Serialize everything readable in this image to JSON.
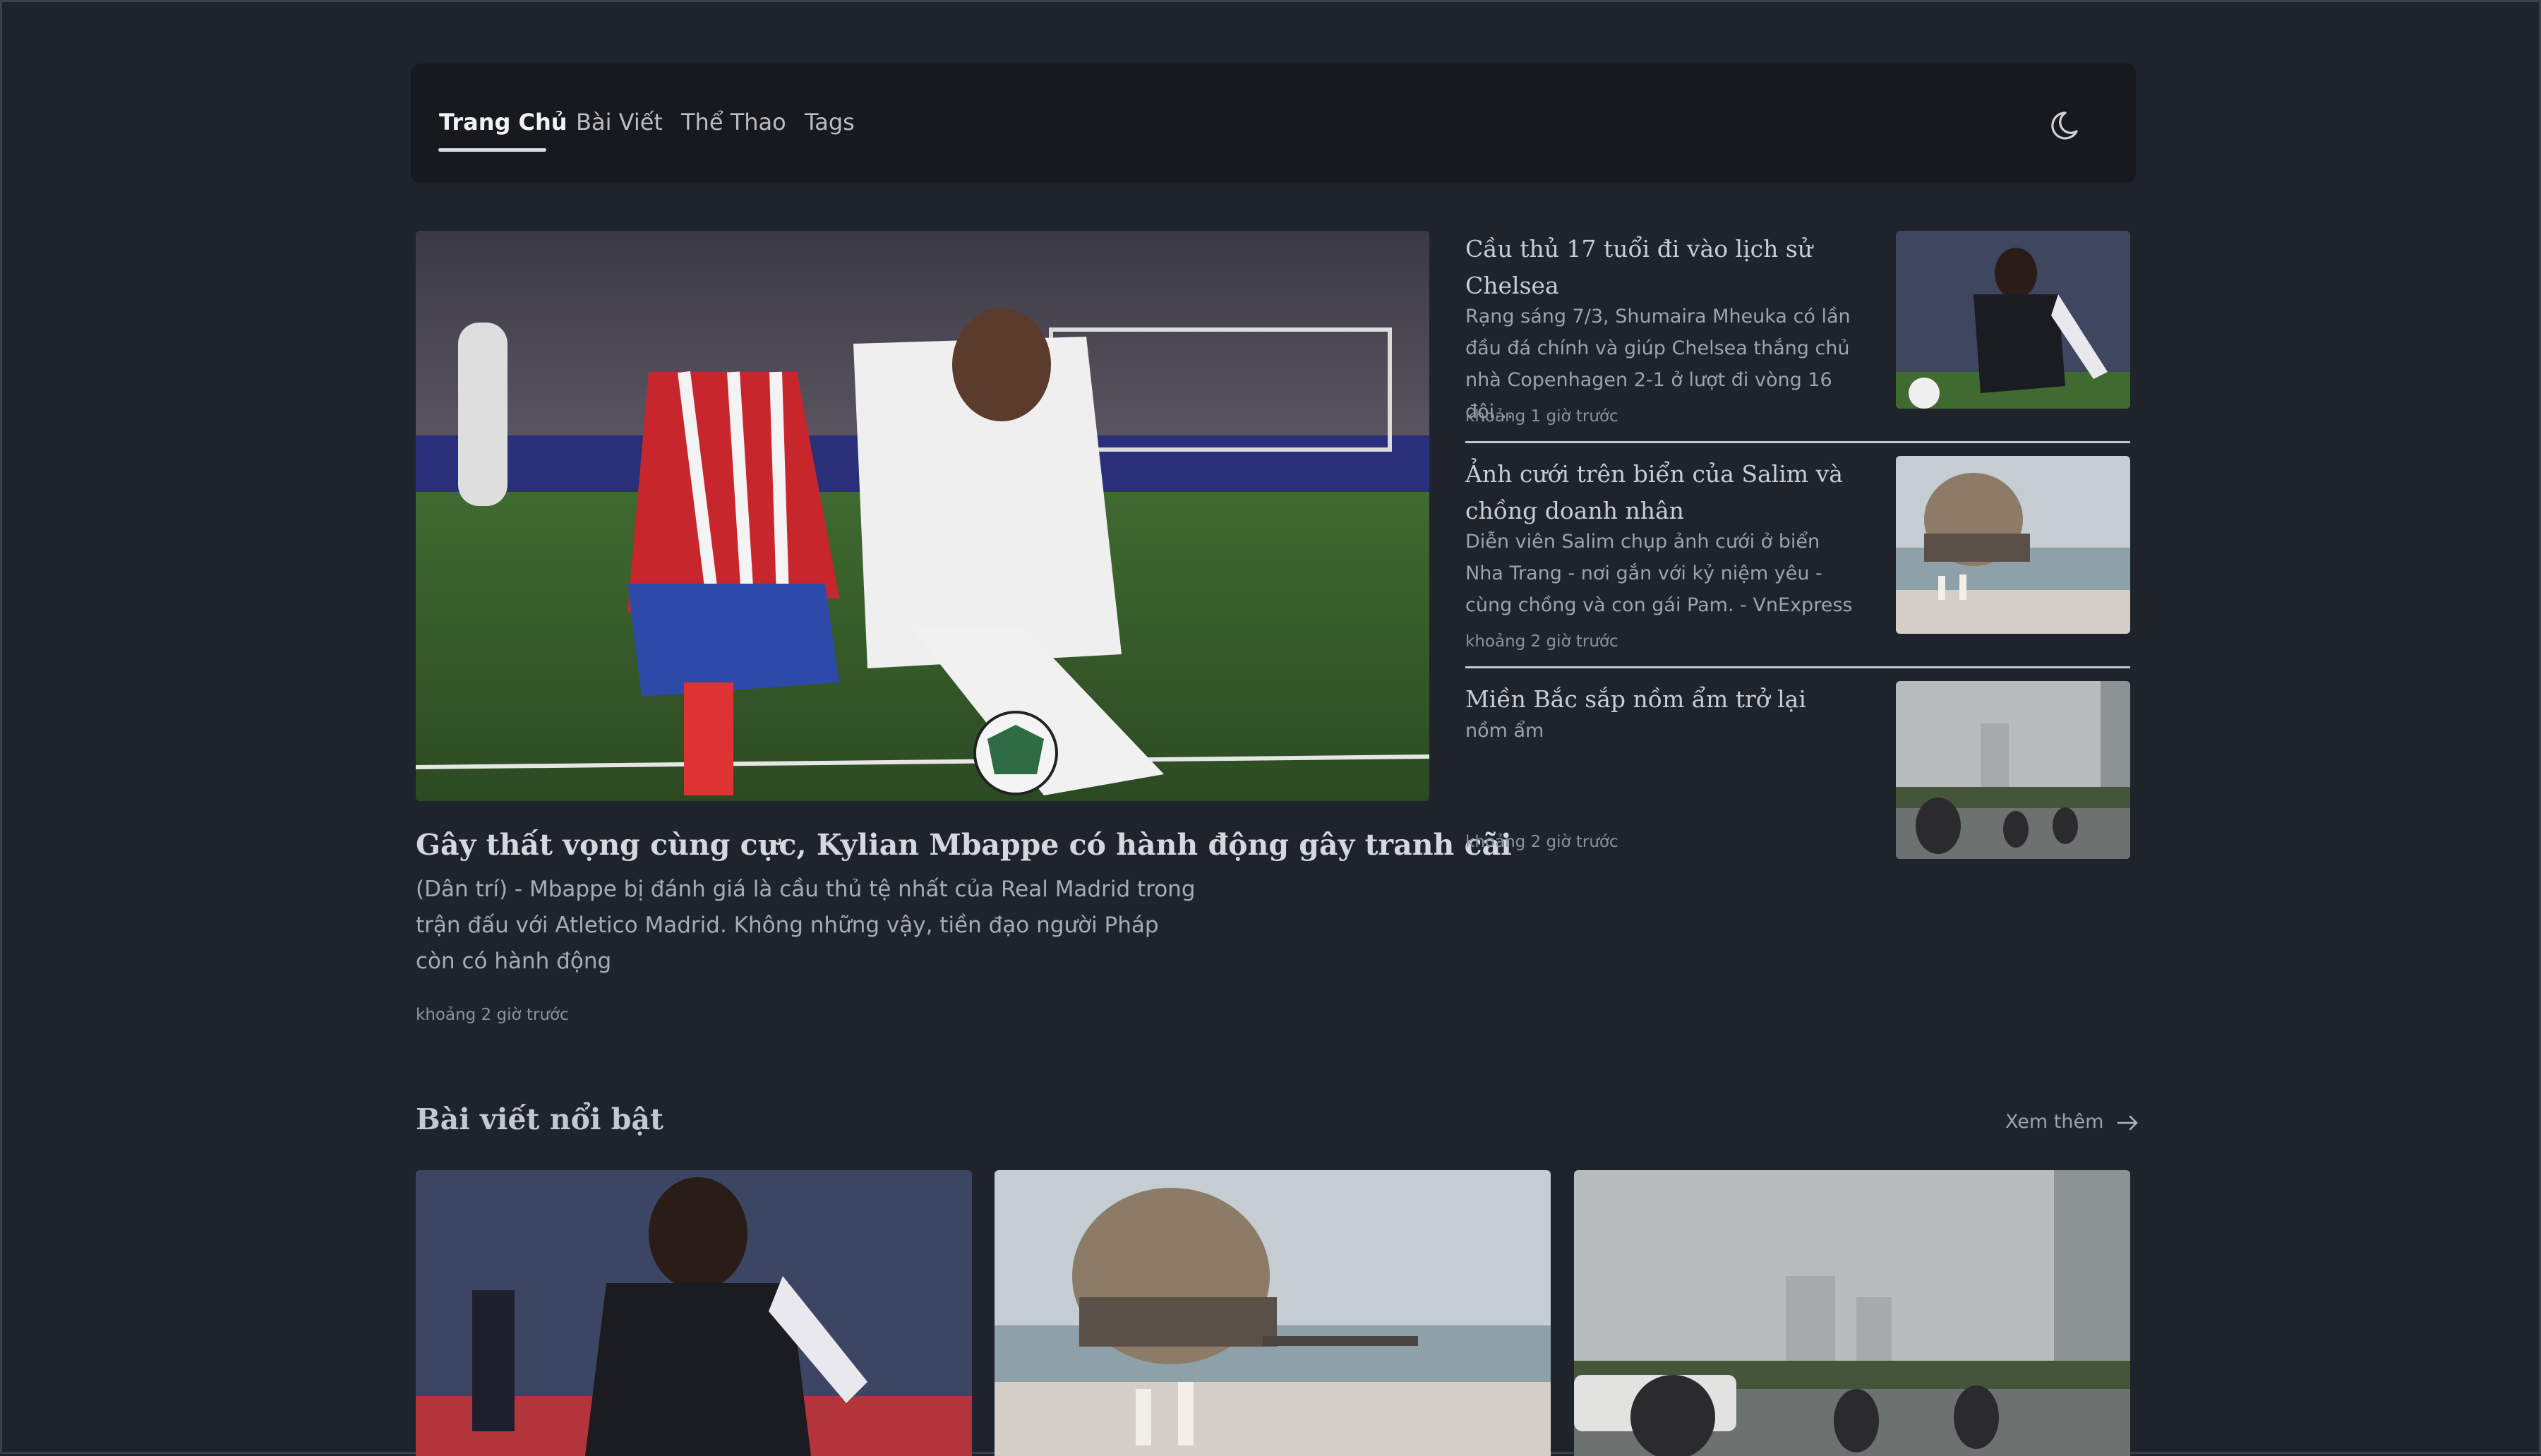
{
  "nav": {
    "items": [
      "Trang Chủ",
      "Bài Viết",
      "Thể Thao",
      "Tags"
    ],
    "active_index": 0,
    "theme_toggle_icon": "moon-icon"
  },
  "hero": {
    "title": "Gây thất vọng cùng cực, Kylian Mbappe có hành động gây tranh cãi",
    "description": "(Dân trí) - Mbappe bị đánh giá là cầu thủ tệ nhất của Real Madrid trong trận đấu với Atletico Madrid. Không những vậy, tiền đạo người Pháp còn có hành động",
    "time": "khoảng 2 giờ trước",
    "image_alt": "football-match-photo"
  },
  "side_articles": [
    {
      "title": "Cầu thủ 17 tuổi đi vào lịch sử Chelsea",
      "description": "Rạng sáng 7/3, Shumaira Mheuka có lần đầu đá chính và giúp Chelsea thắng chủ nhà Copenhagen 2-1 ở lượt đi vòng 16 đội…",
      "time": "khoảng 1 giờ trước"
    },
    {
      "title": "Ảnh cưới trên biển của Salim và chồng doanh nhân",
      "description": "Diễn viên Salim chụp ảnh cưới ở biển Nha Trang - nơi gắn với kỷ niệm yêu - cùng chồng và con gái Pam. - VnExpress",
      "time": "khoảng 2 giờ trước"
    },
    {
      "title": "Miền Bắc sắp nồm ẩm trở lại",
      "description": "nồm ẩm",
      "time": "khoảng 2 giờ trước"
    }
  ],
  "featured": {
    "title": "Bài viết nổi bật",
    "see_more": "Xem thêm"
  },
  "colors": {
    "background": "#1f232b",
    "navbar": "#17191e",
    "text": "#c9ccd3",
    "muted": "#8d919b"
  }
}
